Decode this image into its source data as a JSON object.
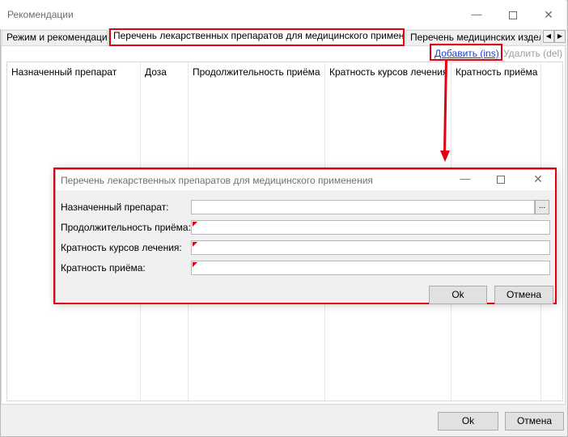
{
  "window": {
    "title": "Рекомендации",
    "minimize_glyph": "—",
    "close_glyph": "✕"
  },
  "tabs": [
    {
      "label": "Режим и рекомендации",
      "active": false
    },
    {
      "label": "Перечень лекарственных препаратов для медицинского применения",
      "active": true
    },
    {
      "label": "Перечень медицинских изделий",
      "active": false
    }
  ],
  "tab_scroll": {
    "left_glyph": "◀",
    "right_glyph": "▶"
  },
  "toolbar": {
    "add_label": "Добавить (ins)",
    "delete_label": "Удалить (del)"
  },
  "grid": {
    "columns": [
      "Назначенный препарат",
      "Доза",
      "Продолжительность приёма",
      "Кратность курсов лечения",
      "Кратность  приёма"
    ],
    "rows": []
  },
  "dialog": {
    "title": "Перечень лекарственных препаратов для медицинского применения",
    "fields": [
      {
        "label": "Назначенный препарат:",
        "value": "",
        "required": false
      },
      {
        "label": "Продолжительность приёма:",
        "value": "",
        "required": true
      },
      {
        "label": "Кратность курсов лечения:",
        "value": "",
        "required": true
      },
      {
        "label": "Кратность  приёма:",
        "value": "",
        "required": true
      }
    ],
    "ellipsis_label": "...",
    "ok_label": "Ok",
    "cancel_label": "Отмена"
  },
  "footer": {
    "ok_label": "Ok",
    "cancel_label": "Отмена"
  },
  "colors": {
    "highlight": "#e0000f",
    "link": "#1a3fd6",
    "disabled_text": "#9d9d9d"
  }
}
